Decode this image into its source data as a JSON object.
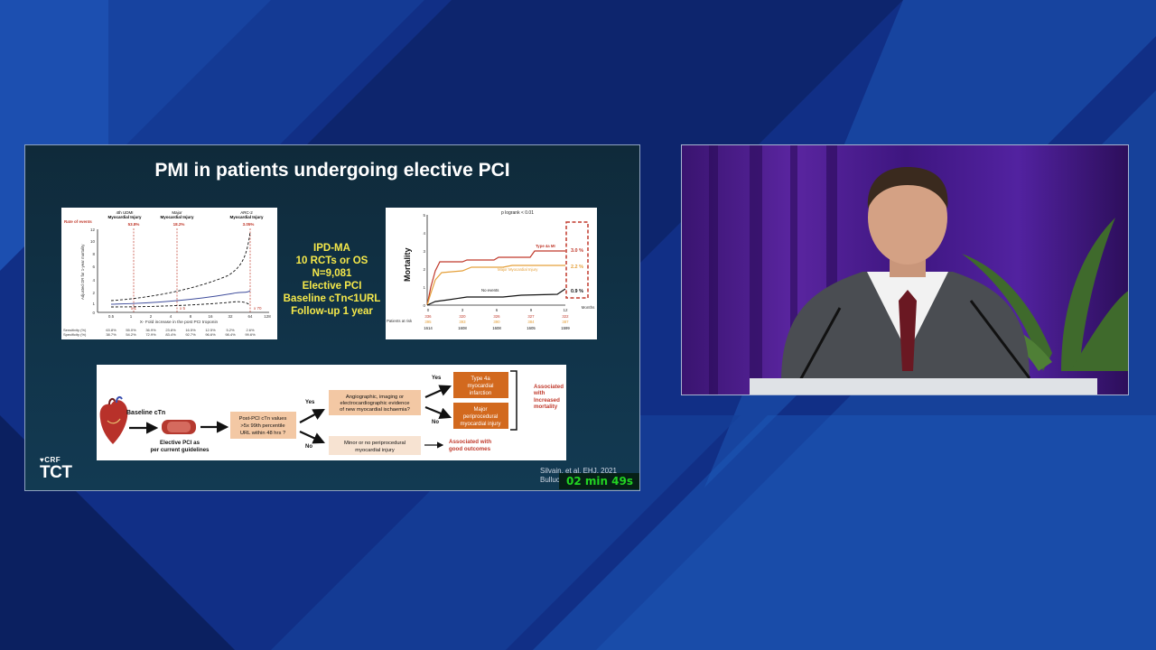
{
  "slide": {
    "title": "PMI in patients undergoing elective PCI",
    "ipd_lines": [
      "IPD-MA",
      "10 RCTs or OS",
      "N=9,081",
      "Elective PCI",
      "Baseline cTn<1URL",
      "Follow-up 1 year"
    ],
    "citation_line1": "Silvain, et al. EHJ. 2021",
    "citation_line2": "Bulluc",
    "timer": "02 min 49s",
    "logo_crf": "CRF",
    "logo_tct": "TCT"
  },
  "odds_figure": {
    "rate_label": "Rate of events",
    "columns": [
      {
        "title1": "4th UDMI",
        "title2": "Myocardial Injury",
        "rate": "53.8%",
        "marker": "x 1"
      },
      {
        "title1": "Major",
        "title2": "Myocardial Injury",
        "rate": "18.2%",
        "marker": "x 5"
      },
      {
        "title1": "ARC-2",
        "title2": "Myocardial Injury",
        "rate": "3.05%",
        "marker": "x 70"
      }
    ],
    "ylabel": "Adjusted OR for 1-year mortality",
    "xlabel": "X- Fold increase in the post PCI troponin",
    "y_ticks": [
      "0",
      "1",
      "2",
      "4",
      "6",
      "8",
      "10",
      "12"
    ],
    "x_ticks": [
      "0.5",
      "1",
      "2",
      "4",
      "8",
      "16",
      "32",
      "64",
      "128"
    ],
    "sens_label": "Sensitivity (%)",
    "spec_label": "Specificity (%)",
    "sensitivity": [
      "63.8%",
      "55.0%",
      "36.9%",
      "23.8%",
      "16.5%",
      "12.5%",
      "5.2%",
      "2.6%"
    ],
    "specificity": [
      "38.7%",
      "54.2%",
      "72.9%",
      "83.4%",
      "92.7%",
      "96.6%",
      "98.4%",
      "99.6%"
    ]
  },
  "km_figure": {
    "title": "p logrank < 0.01",
    "ylabel": "Mortality",
    "xlabel": "Months",
    "y_ticks": [
      "0",
      "1",
      "2",
      "3",
      "4",
      "5"
    ],
    "x_ticks": [
      "0",
      "3",
      "6",
      "9",
      "12"
    ],
    "series": [
      {
        "name": "Type 4a MI",
        "end": "3.0 %",
        "color": "#c0392b"
      },
      {
        "name": "Major Myocardial Injury",
        "end": "2.2 %",
        "color": "#e5a03a"
      },
      {
        "name": "No events",
        "end": "0.9 %",
        "color": "#111111"
      }
    ],
    "at_risk_label": "Patients at risk",
    "at_risk": [
      [
        "336",
        "320",
        "326",
        "327",
        "322"
      ],
      [
        "395",
        "393",
        "390",
        "384",
        "387"
      ],
      [
        "1614",
        "1608",
        "1608",
        "1605",
        "1599"
      ]
    ]
  },
  "flow": {
    "baseline": "Baseline cTn",
    "elective_line1": "Elective PCI as",
    "elective_line2": "per current guidelines",
    "postpci": [
      "Post-PCI cTn values",
      ">5x 99th percentile",
      "URL within 48 hrs ?"
    ],
    "yes": "Yes",
    "no": "No",
    "angio": [
      "Angiographic, imaging or",
      "electrocardiographic evidence",
      "of new myocardial ischaemia?"
    ],
    "type4a": [
      "Type 4a",
      "myocardial",
      "infarction"
    ],
    "major": [
      "Major",
      "periprocedural",
      "myocardial injury"
    ],
    "minor": [
      "Minor or no periprocedural",
      "myocardial injury"
    ],
    "assoc_increased": [
      "Associated",
      "with",
      "Increased",
      "mortality"
    ],
    "assoc_good": [
      "Associated with",
      "good outcomes"
    ]
  }
}
